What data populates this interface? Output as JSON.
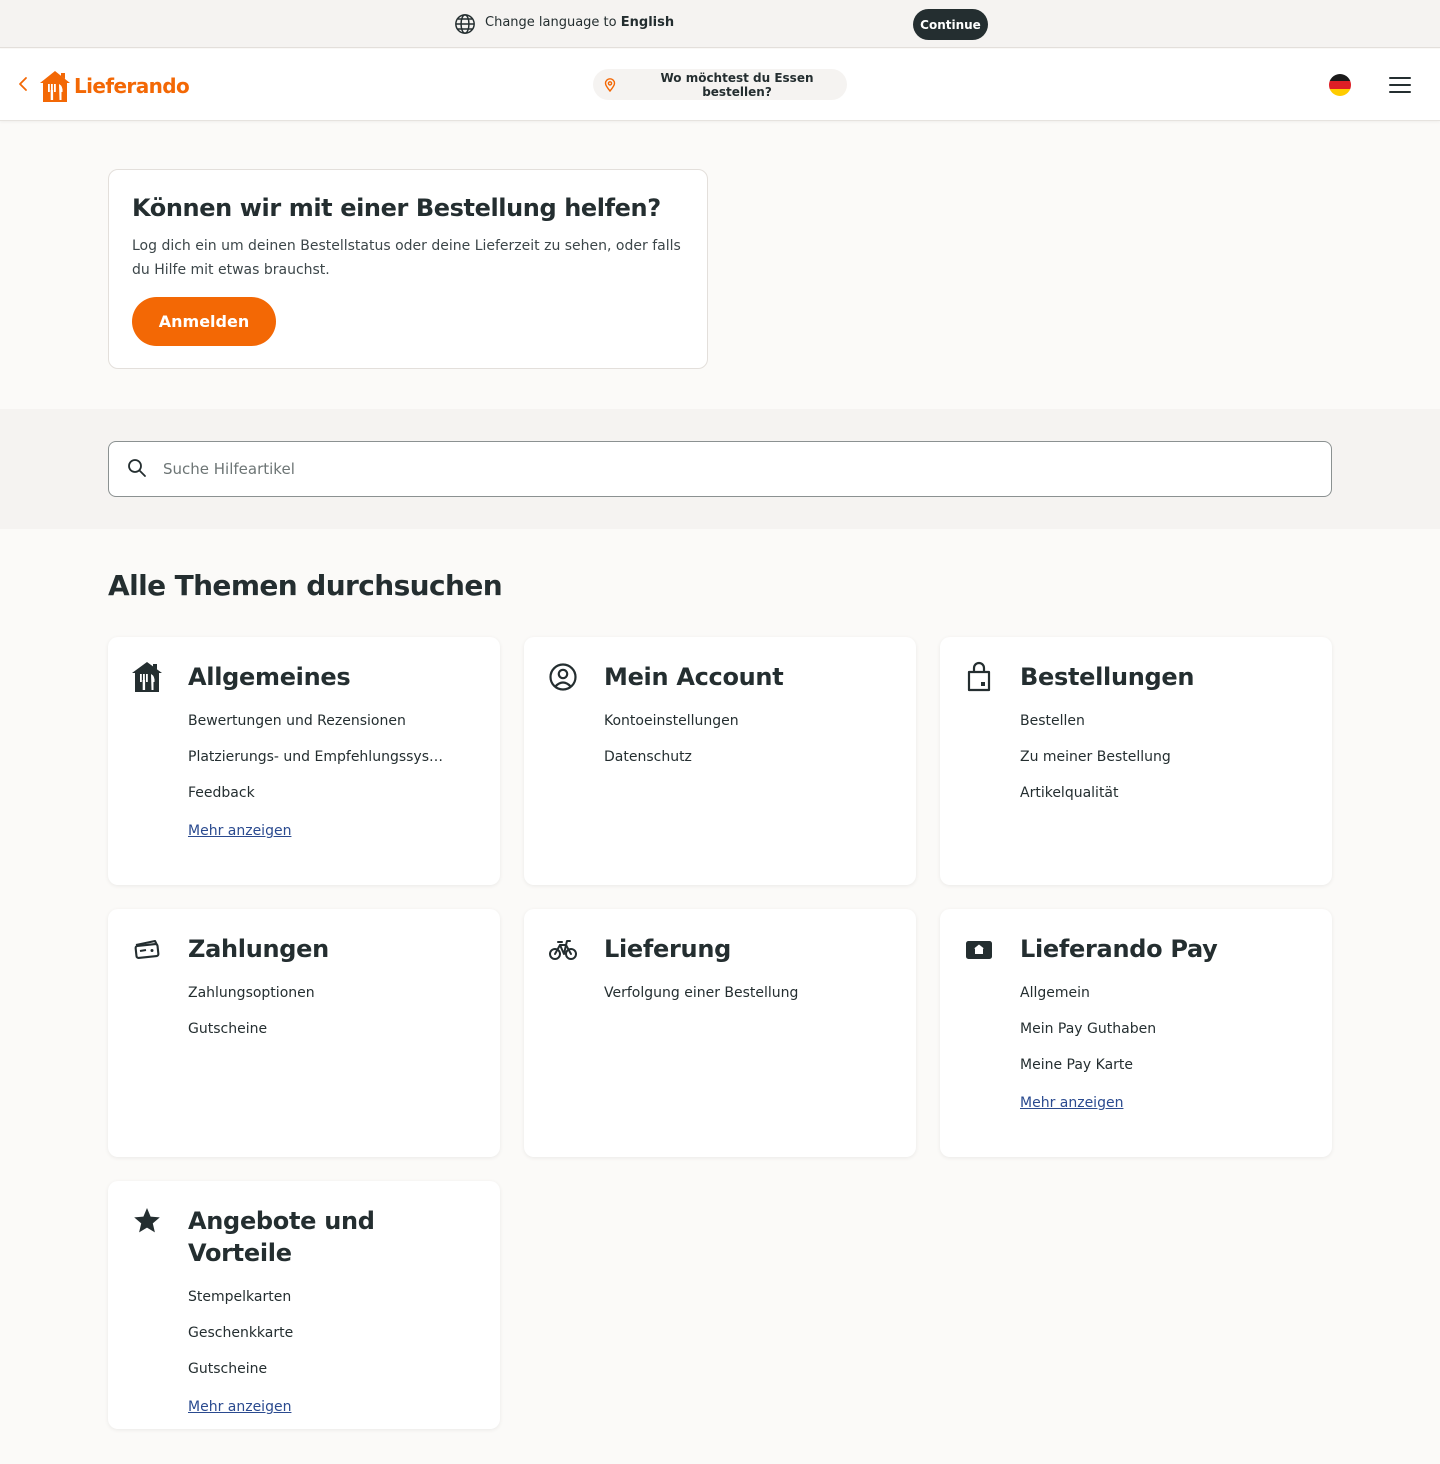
{
  "language_bar": {
    "prefix": "Change language to",
    "language": "English",
    "continue_label": "Continue"
  },
  "header": {
    "logo_text": "Lieferando",
    "address_prompt": "Wo möchtest du Essen bestellen?",
    "icons": [
      "back-chevron-icon",
      "lieferando-house-icon",
      "location-pin-icon",
      "german-flag-icon",
      "hamburger-menu-icon"
    ]
  },
  "login_card": {
    "title": "Können wir mit einer Bestellung helfen?",
    "text": "Log dich ein um deinen Bestellstatus oder deine Lieferzeit zu sehen, oder falls du Hilfe mit etwas brauchst.",
    "button_label": "Anmelden"
  },
  "search": {
    "placeholder": "Suche Hilfeartikel"
  },
  "topics_section": {
    "title": "Alle Themen durchsuchen",
    "topics": [
      {
        "title": "Allgemeines",
        "icon": "lieferando-house-icon",
        "items": [
          "Bewertungen und Rezensionen",
          "Platzierungs- und Empfehlungssys…",
          "Feedback"
        ],
        "more_label": "Mehr anzeigen"
      },
      {
        "title": "Mein Account",
        "icon": "user-circle-icon",
        "items": [
          "Kontoeinstellungen",
          "Datenschutz"
        ]
      },
      {
        "title": "Bestellungen",
        "icon": "shopping-bag-icon",
        "items": [
          "Bestellen",
          "Zu meiner Bestellung",
          "Artikelqualität"
        ]
      },
      {
        "title": "Zahlungen",
        "icon": "payment-card-icon",
        "items": [
          "Zahlungsoptionen",
          "Gutscheine"
        ]
      },
      {
        "title": "Lieferung",
        "icon": "bicycle-icon",
        "items": [
          "Verfolgung einer Bestellung"
        ]
      },
      {
        "title": "Lieferando Pay",
        "icon": "wallet-icon",
        "items": [
          "Allgemein",
          "Mein Pay Guthaben",
          "Meine Pay Karte"
        ],
        "more_label": "Mehr anzeigen"
      },
      {
        "title": "Angebote und Vorteile",
        "icon": "star-icon",
        "items": [
          "Stempelkarten",
          "Geschenkkarte",
          "Gutscheine"
        ],
        "more_label": "Mehr anzeigen"
      }
    ]
  },
  "colors": {
    "brand_orange": "#f36805",
    "text_dark": "#242e30",
    "link_blue": "#2a4a8f",
    "band_beige": "#f5f3f1",
    "page_bg": "#fbfaf8"
  }
}
